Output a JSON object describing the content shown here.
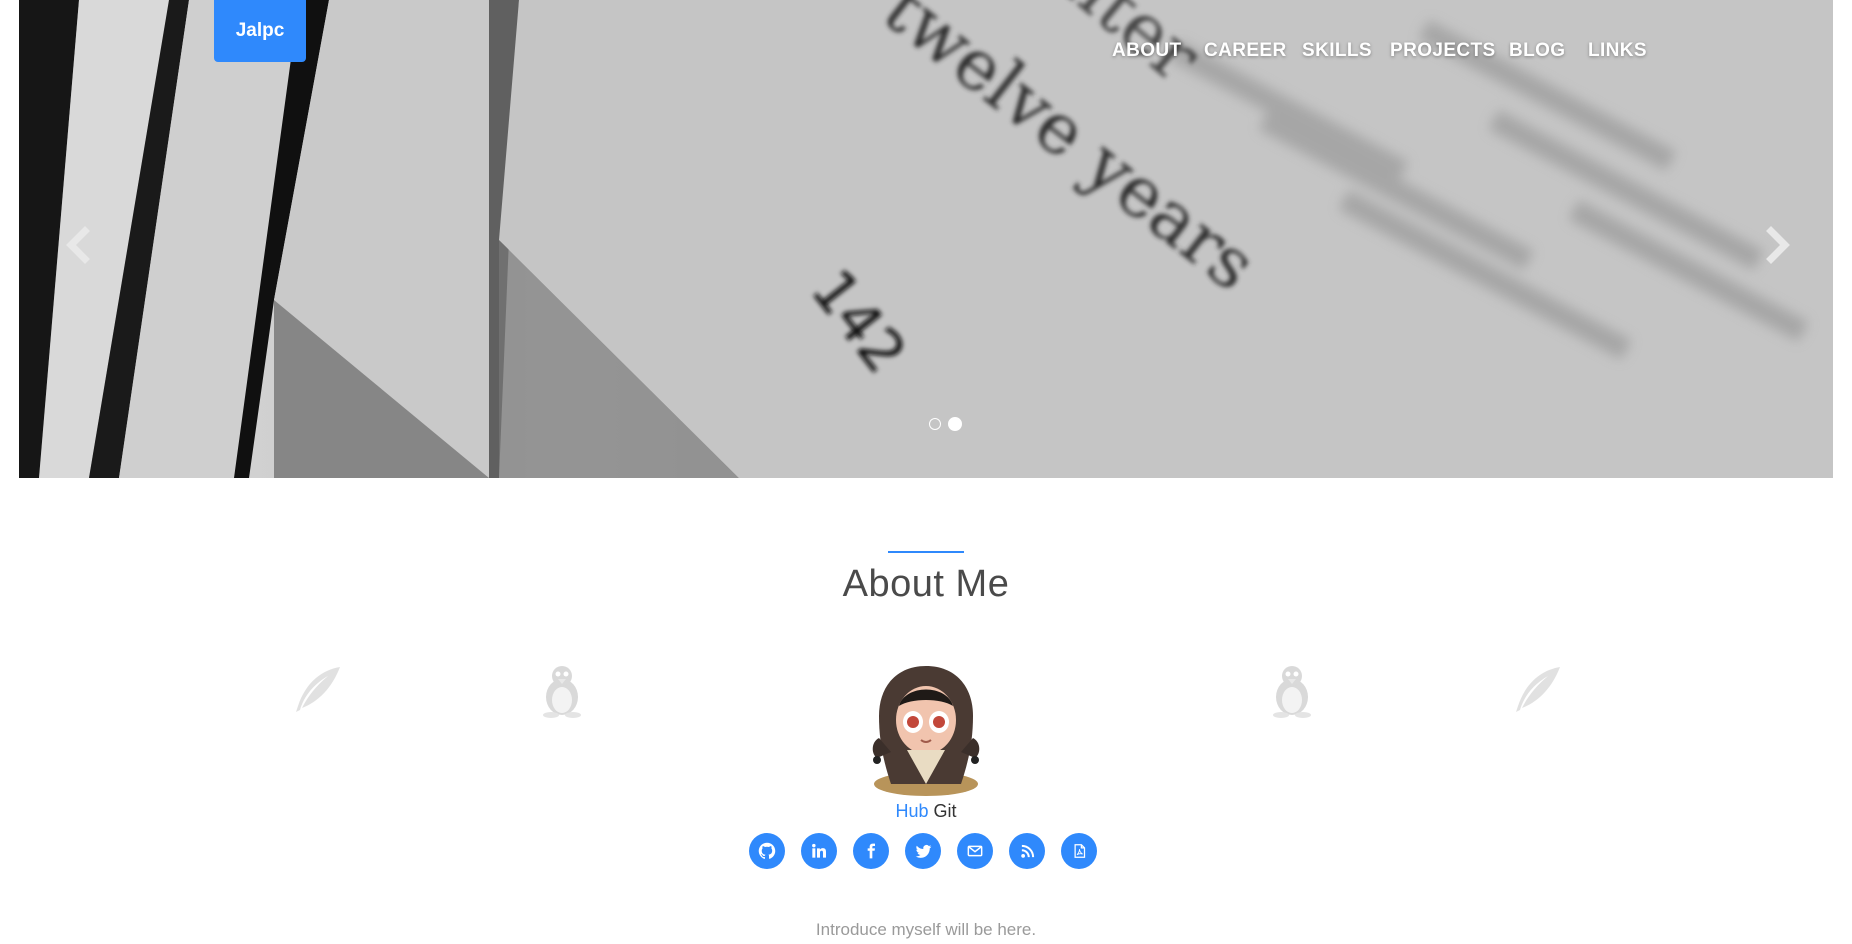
{
  "brand": "Jalpc",
  "nav": [
    "ABOUT",
    "CAREER",
    "SKILLS",
    "PROJECTS",
    "BLOG",
    "LINKS"
  ],
  "hero": {
    "photo_text": {
      "line1": "twelve years",
      "line2": "enter",
      "page": "142"
    },
    "slide_count": 2,
    "active_slide": 2
  },
  "about": {
    "title": "About Me",
    "handle_highlight": "Hub",
    "handle_rest": "Git",
    "intro": "Introduce myself will be here."
  },
  "social_icons": [
    "github-icon",
    "linkedin-icon",
    "facebook-icon",
    "twitter-icon",
    "mail-icon",
    "rss-icon",
    "pdf-icon"
  ],
  "colors": {
    "accent": "#2f89fc",
    "heading": "#4a4a4a",
    "muted": "#9a9a9a",
    "nav_text": "#ffffff"
  }
}
